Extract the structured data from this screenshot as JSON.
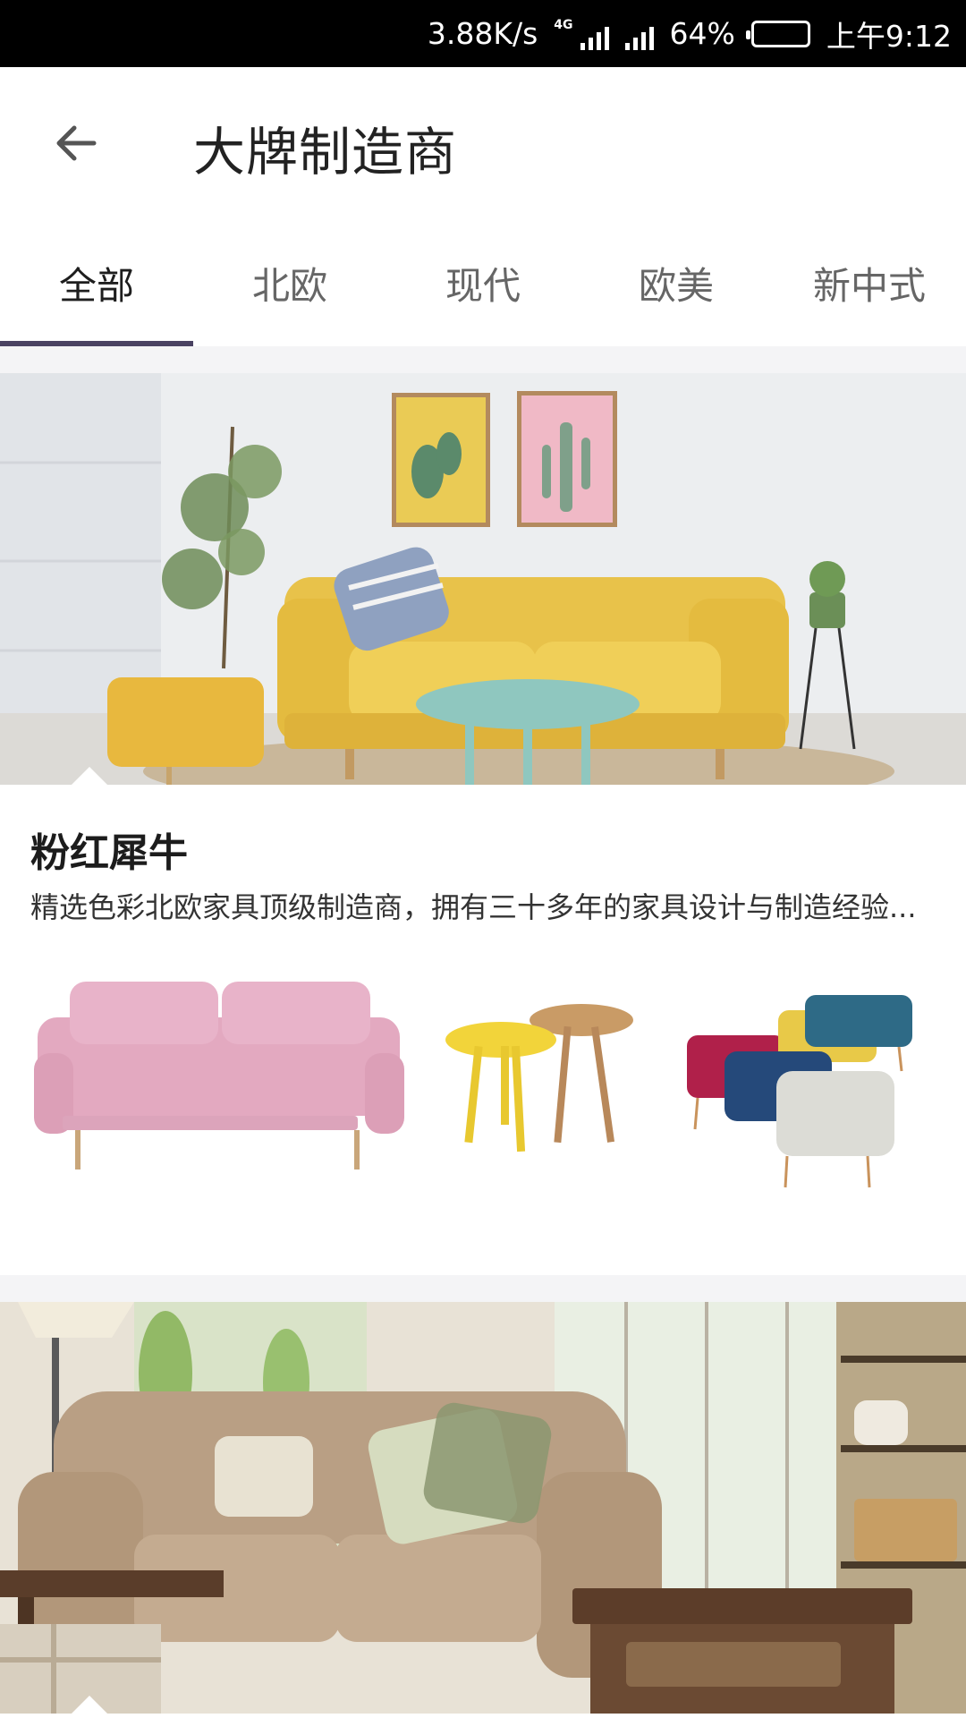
{
  "status_bar": {
    "speed": "3.88K/s",
    "network": "4G",
    "battery": "64%",
    "time": "上午9:12"
  },
  "header": {
    "title": "大牌制造商"
  },
  "tabs": [
    {
      "label": "全部",
      "active": true
    },
    {
      "label": "北欧",
      "active": false
    },
    {
      "label": "现代",
      "active": false
    },
    {
      "label": "欧美",
      "active": false
    },
    {
      "label": "新中式",
      "active": false
    }
  ],
  "brands": [
    {
      "name": "粉红犀牛",
      "description": "精选色彩北欧家具顶级制造商，拥有三十多年的家具设计与制造经验..."
    }
  ],
  "colors": {
    "tab_indicator": "#4a4262",
    "sofa_yellow": "#e8c24a",
    "sofa_pink": "#e3a9c0",
    "gap": "#f4f4f6"
  }
}
